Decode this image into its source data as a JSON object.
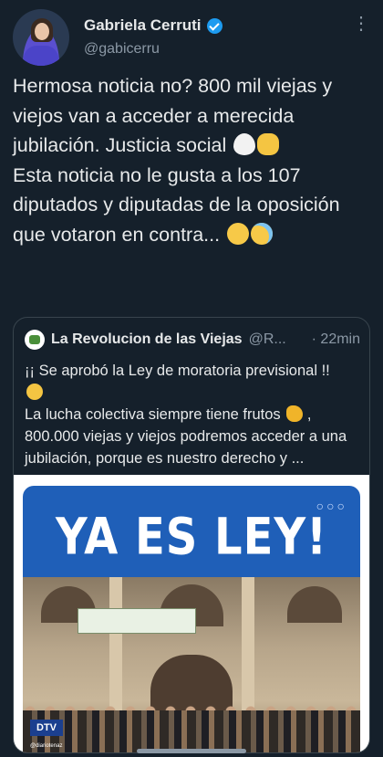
{
  "author": {
    "name": "Gabriela Cerruti",
    "handle": "@gabicerru"
  },
  "tweet": {
    "line1": "Hermosa noticia no? 800 mil viejas y viejos van a acceder a merecida jubilación. Justicia social",
    "line2": "Esta noticia no le gusta a los 107 diputados y diputadas de la oposición que votaron en contra..."
  },
  "quote": {
    "name": "La Revolucion de las Viejas",
    "handle": "@R...",
    "time": "· 22min",
    "text1": "¡¡ Se aprobó la Ley de moratoria previsional !!",
    "text2": "La lucha colectiva siempre tiene frutos",
    "text3": ", 800.000 viejas y viejos podremos acceder a una jubilación, porque es nuestro derecho y ...",
    "image": {
      "title": "YA ES LEY!",
      "dots": "○○○",
      "logo": "DTV",
      "logo_handle": "@diariotenaz"
    }
  },
  "icons": [
    "verified-badge-icon",
    "more-options-icon",
    "heart-emoji",
    "clap-emoji",
    "yawn-emoji",
    "sweat-smile-emoji",
    "party-emoji",
    "muscle-emoji"
  ],
  "colors": {
    "background": "#15202b",
    "text": "#e7e9ea",
    "secondary_text": "#8b98a5",
    "verified": "#1d9bf0",
    "border": "#38444d",
    "banner": "#1f5fb8"
  }
}
